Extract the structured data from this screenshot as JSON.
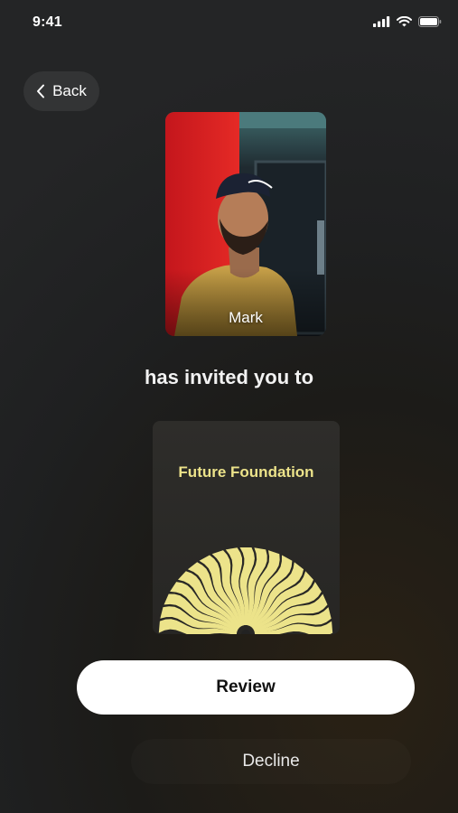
{
  "status_bar": {
    "time": "9:41",
    "icons": [
      "signal-icon",
      "wifi-icon",
      "battery-icon"
    ]
  },
  "nav": {
    "back_label": "Back"
  },
  "inviter": {
    "name": "Mark"
  },
  "invite_text": "has invited you to",
  "group": {
    "title": "Future Foundation",
    "accent_color": "#ece38a"
  },
  "actions": {
    "review_label": "Review",
    "decline_label": "Decline"
  }
}
